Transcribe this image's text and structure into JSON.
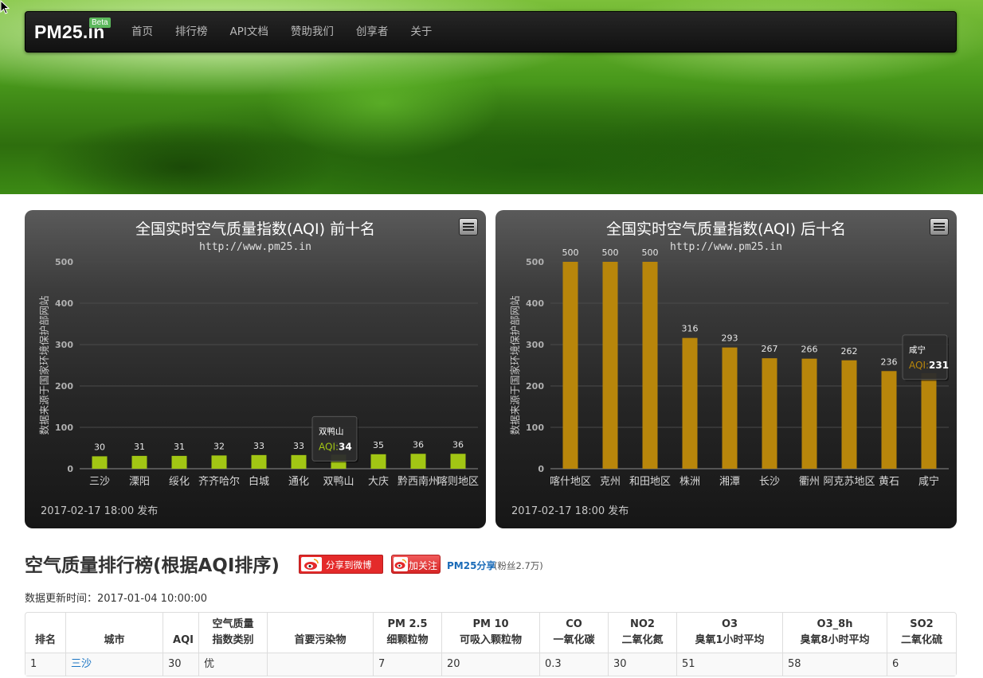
{
  "nav": {
    "brand": "PM25.in",
    "beta": "Beta",
    "items": [
      "首页",
      "排行榜",
      "API文档",
      "赞助我们",
      "创享者",
      "关于"
    ]
  },
  "charts": [
    {
      "title": "全国实时空气质量指数(AQI) 前十名",
      "subtitle": "http://www.pm25.in",
      "ylabel": "数据来源于国家环境保护部网站",
      "footer": "2017-02-17 18:00 发布",
      "tooltip": {
        "city": "双鸭山",
        "label": "AQI:",
        "value": "34"
      },
      "color": "#a2c614"
    },
    {
      "title": "全国实时空气质量指数(AQI) 后十名",
      "subtitle": "http://www.pm25.in",
      "ylabel": "数据来源于国家环境保护部网站",
      "footer": "2017-02-17 18:00 发布",
      "tooltip": {
        "city": "咸宁",
        "label": "AQI:",
        "value": "231"
      },
      "color": "#b8860b"
    }
  ],
  "chart_data": [
    {
      "type": "bar",
      "title": "全国实时空气质量指数(AQI) 前十名",
      "subtitle": "http://www.pm25.in",
      "ylabel": "数据来源于国家环境保护部网站",
      "categories": [
        "三沙",
        "溧阳",
        "绥化",
        "齐齐哈尔",
        "白城",
        "通化",
        "双鸭山",
        "大庆",
        "黔西南州",
        "喀则地区"
      ],
      "values": [
        30,
        31,
        31,
        32,
        33,
        33,
        34,
        35,
        36,
        36
      ],
      "ylim": [
        0,
        500
      ],
      "yticks": [
        0,
        100,
        200,
        300,
        400,
        500
      ],
      "grid": true,
      "legend": "none"
    },
    {
      "type": "bar",
      "title": "全国实时空气质量指数(AQI) 后十名",
      "subtitle": "http://www.pm25.in",
      "ylabel": "数据来源于国家环境保护部网站",
      "categories": [
        "喀什地区",
        "克州",
        "和田地区",
        "株洲",
        "湘潭",
        "长沙",
        "衢州",
        "阿克苏地区",
        "黄石",
        "咸宁"
      ],
      "values": [
        500,
        500,
        500,
        316,
        293,
        267,
        266,
        262,
        236,
        231
      ],
      "ylim": [
        0,
        500
      ],
      "yticks": [
        0,
        100,
        200,
        300,
        400,
        500
      ],
      "grid": true,
      "legend": "none"
    }
  ],
  "ranking": {
    "title": "空气质量排行榜(根据AQI排序)",
    "share_label": "分享到微博",
    "follow_label": "加关注",
    "account": "PM25分享",
    "fans": "(粉丝2.7万)",
    "update_time": "数据更新时间：2017-01-04 10:00:00",
    "headers": [
      [
        "排名",
        ""
      ],
      [
        "城市",
        ""
      ],
      [
        "AQI",
        ""
      ],
      [
        "空气质量",
        "指数类别"
      ],
      [
        "首要污染物",
        ""
      ],
      [
        "PM 2.5",
        "细颗粒物"
      ],
      [
        "PM 10",
        "可吸入颗粒物"
      ],
      [
        "CO",
        "一氧化碳"
      ],
      [
        "NO2",
        "二氧化氮"
      ],
      [
        "O3",
        "臭氧1小时平均"
      ],
      [
        "O3_8h",
        "臭氧8小时平均"
      ],
      [
        "SO2",
        "二氧化硫"
      ]
    ],
    "rows": [
      [
        "1",
        "三沙",
        "30",
        "优",
        "",
        "7",
        "20",
        "0.3",
        "30",
        "51",
        "58",
        "6"
      ]
    ]
  }
}
